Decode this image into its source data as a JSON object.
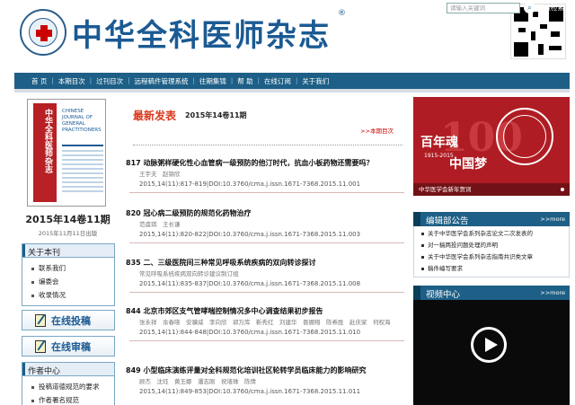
{
  "header": {
    "journal_name": "中华全科医师杂志",
    "reg_mark": "®"
  },
  "nav": {
    "items": [
      "首 页",
      "本期目次",
      "过刊目次",
      "远程稿件管理系统",
      "往期集锦",
      "帮 助",
      "在线订阅",
      "关于我们"
    ],
    "search_placeholder": "请输入关键词",
    "advanced_search": "高级检索"
  },
  "issue": {
    "title": "2015年14卷11期",
    "published": "2015年11月11日出版",
    "cover_cn": "中华全科医师杂志",
    "cover_en": "CHINESE JOURNAL OF GENERAL PRACTITIONERS"
  },
  "about": {
    "heading": "关于本刊",
    "items": [
      "联系我们",
      "编委会",
      "收录情况"
    ]
  },
  "buttons": {
    "submit": "在线投稿",
    "review": "在线审稿"
  },
  "author_center": {
    "heading": "作者中心",
    "items": [
      "投稿道德规范的要求",
      "作者署名规范"
    ]
  },
  "latest": {
    "heading": "最新发表",
    "issue": "2015年14卷11期",
    "more": ">>本期目次"
  },
  "articles": [
    {
      "title": "817 动脉粥样硬化性心血管病一级预防的他汀时代，抗血小板药物还需要吗？",
      "authors": "王宇夫　赵锦欣",
      "doi": "2015,14(11):817-819|DOI:10.3760/cma.j.issn.1671-7368.2015.11.001"
    },
    {
      "title": "820 冠心病二级预防的规范化药物治疗",
      "authors": "范虞琪　王长谦",
      "doi": "2015,14(11):820-822|DOI:10.3760/cma.j.issn.1671-7368.2015.11.003"
    },
    {
      "title": "835 二、三级医院间三种常见呼吸系统疾病的双向转诊探讨",
      "authors": "常见呼吸系统疾病双向转诊建议制订组",
      "doi": "2015,14(11):835-837|DOI:10.3760/cma.j.issn.1671-7368.2015.11.008"
    },
    {
      "title": "844 北京市郊区支气管哮喘控制情况多中心调查结果初步报告",
      "authors": "张永祥　余春晓　安骥威　李向欣　郭万库　靳秀红　刘建华　晋娜翔　陈希胜　赴庆家　何权海",
      "doi": "2015,14(11):844-848|DOI:10.3760/cma.j.issn.1671-7368.2015.11.010"
    },
    {
      "title": "849 小型临床演练评量对全科规范化培训社区轮转学员临床能力的影响研究",
      "authors": "顾杰　沈珏　黄玉娜　潘志刚　祝墡珠　陈倩",
      "doi": "2015,14(11):849-853|DOI:10.3760/cma.j.issn.1671-7368.2015.11.011"
    }
  ],
  "banner": {
    "caption": "中华医学会新年贺词",
    "years": "1915-2015",
    "text_cn": "百年魂",
    "text_cn2": "中国梦"
  },
  "notices": {
    "heading": "编辑部公告",
    "more": ">>more",
    "items": [
      "关于中华医学会系列杂志论文二次发表的",
      "对一稿两投问题处理的声明",
      "关于中华医学会系列杂志指南共识类文章",
      "稿件编写要求"
    ]
  },
  "video": {
    "heading": "视频中心",
    "more": ">>more"
  }
}
